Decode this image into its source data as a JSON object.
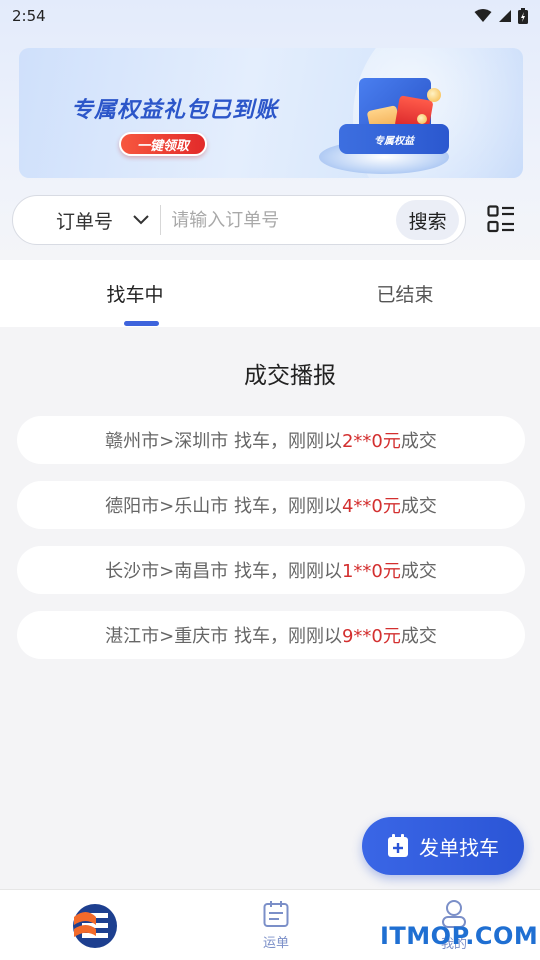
{
  "status_bar": {
    "time": "2:54"
  },
  "banner": {
    "title": "专属权益礼包已到账",
    "button_label": "一键领取",
    "plate_label": "专属权益"
  },
  "search": {
    "select_value": "订单号",
    "placeholder": "请输入订单号",
    "button_label": "搜索"
  },
  "tabs": [
    {
      "label": "找车中",
      "active": true
    },
    {
      "label": "已结束",
      "active": false
    }
  ],
  "report": {
    "title": "成交播报",
    "items": [
      {
        "route": "赣州市>深圳市 找车，刚刚以 ",
        "price": "2**0元",
        "suffix": " 成交"
      },
      {
        "route": "德阳市>乐山市 找车，刚刚以 ",
        "price": "4**0元",
        "suffix": " 成交"
      },
      {
        "route": "长沙市>南昌市 找车，刚刚以 ",
        "price": "1**0元",
        "suffix": " 成交"
      },
      {
        "route": "湛江市>重庆市 找车，刚刚以 ",
        "price": "9**0元",
        "suffix": " 成交"
      }
    ]
  },
  "fab": {
    "label": "发单找车"
  },
  "bottom_nav": {
    "items": [
      {
        "label": "",
        "icon": "app-logo-icon"
      },
      {
        "label": "运单",
        "icon": "calendar-icon"
      },
      {
        "label": "我的",
        "icon": "user-icon"
      }
    ]
  },
  "watermark": "ITMOP.COM",
  "colors": {
    "accent": "#3a66e6",
    "price": "#d32f2f"
  }
}
